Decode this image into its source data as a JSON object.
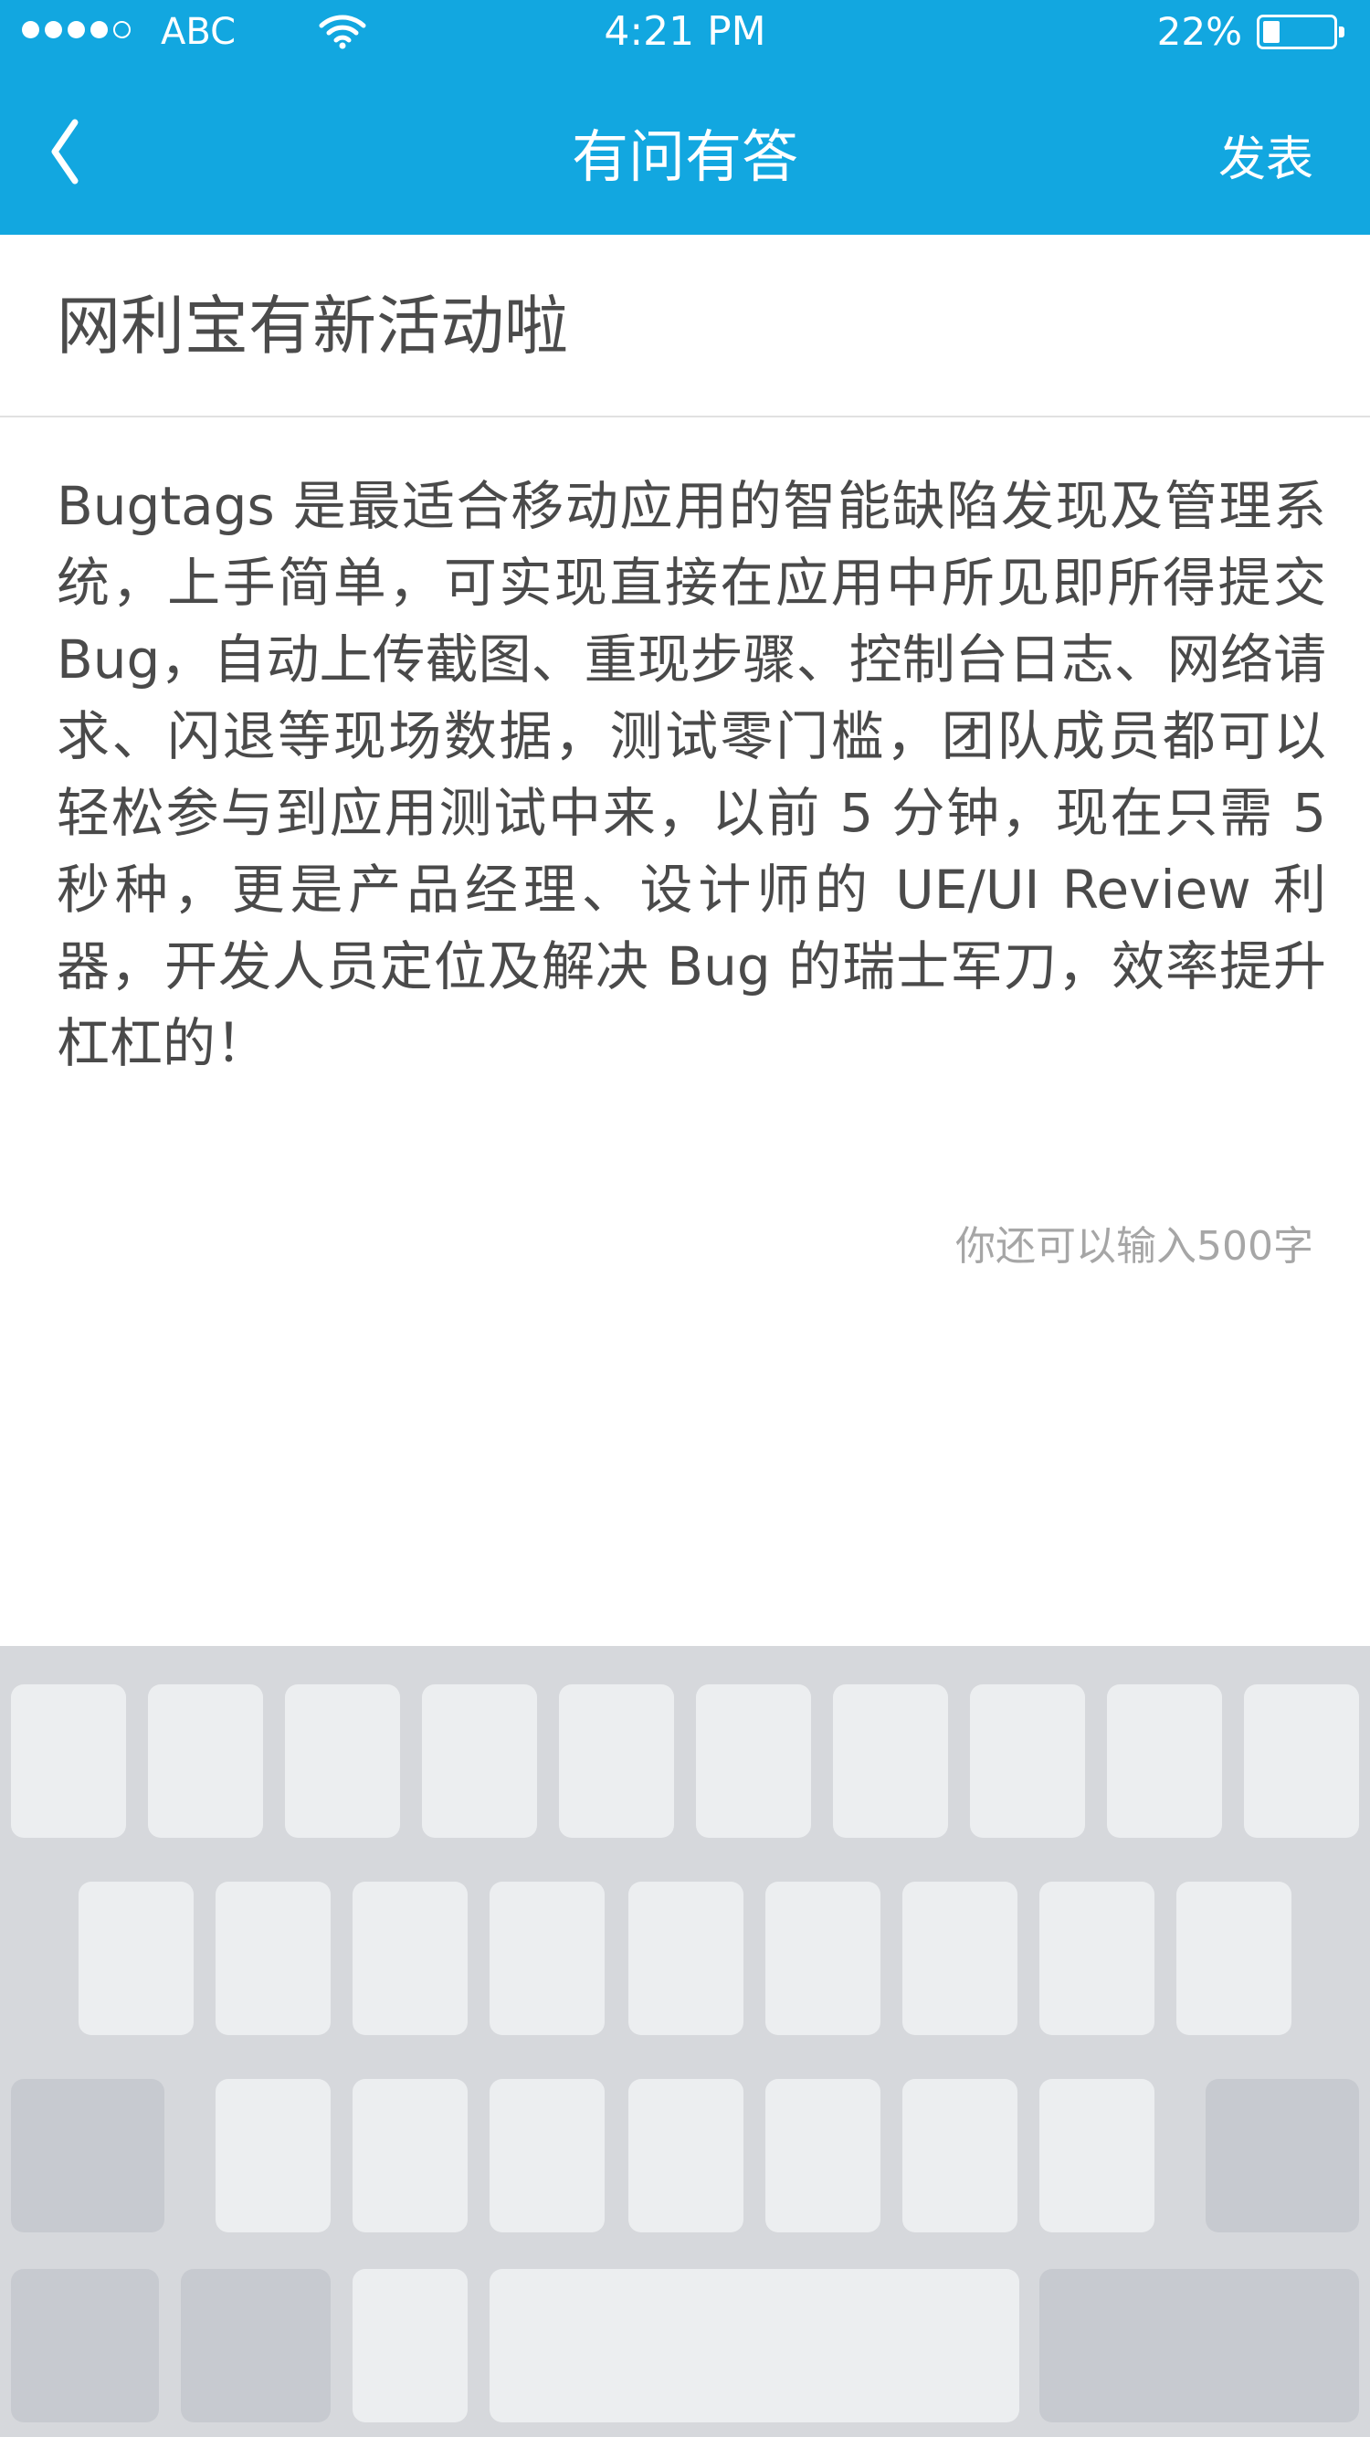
{
  "status_bar": {
    "carrier": "ABC",
    "time": "4:21 PM",
    "battery_percent_label": "22%",
    "battery_level": 0.22,
    "signal_bars_filled": 4,
    "signal_bars_total": 5
  },
  "nav": {
    "back_icon": "chevron-left-icon",
    "title": "有问有答",
    "publish_label": "发表"
  },
  "compose": {
    "title": "网利宝有新活动啦",
    "body": "Bugtags 是最适合移动应用的智能缺陷发现及管理系统，上手简单，可实现直接在应用中所见即所得提交 Bug，自动上传截图、重现步骤、控制台日志、网络请求、闪退等现场数据，测试零门槛，团队成员都可以轻松参与到应用测试中来，以前 5 分钟，现在只需 5 秒种，更是产品经理、设计师的 UE/UI Review 利器，开发人员定位及解决 Bug 的瑞士军刀，效率提升杠杠的！",
    "remaining_count_label": "你还可以输入500字"
  },
  "colors": {
    "header": "#12a7e0",
    "keyboard_bg": "#d6d8dc",
    "key_light": "#eceef0",
    "key_dark": "#c7cad0",
    "counter_text": "#a6a6a6"
  }
}
